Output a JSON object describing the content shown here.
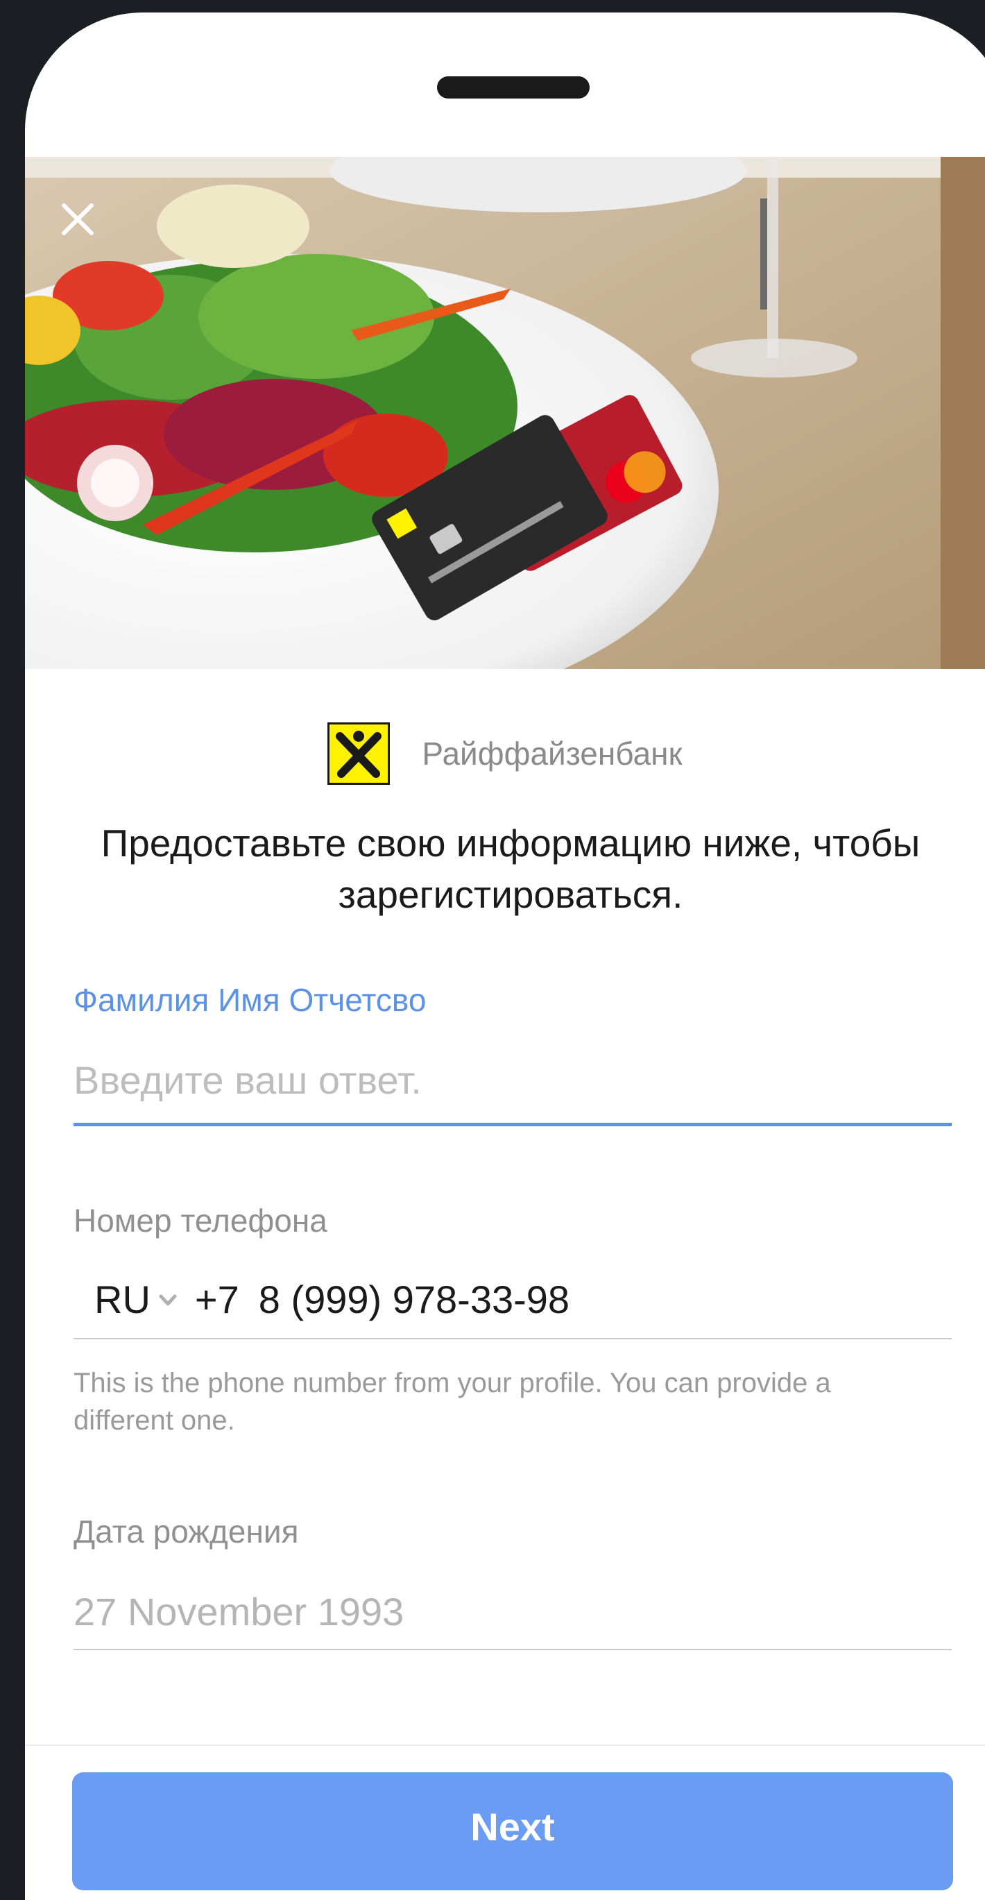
{
  "header": {
    "close_icon": "close-icon",
    "hero_image": "salad-with-raiffeisen-cards"
  },
  "brand": {
    "name": "Райффайзенбанк",
    "logo_icon": "raiffeisen-logo",
    "logo_color": "#fff200"
  },
  "form": {
    "headline": "Предоставьте свою информацию ниже, чтобы зарегистироваться.",
    "full_name": {
      "label": "Фамилия Имя Отчетсво",
      "placeholder": "Введите ваш ответ.",
      "value": ""
    },
    "phone": {
      "label": "Номер телефона",
      "country_code": "RU",
      "dial_code": "+7",
      "value": "8 (999) 978-33-98",
      "hint": "This is the phone number from your profile. You can provide a different one."
    },
    "birth_date": {
      "label": "Дата рождения",
      "value": "27 November 1993"
    }
  },
  "footer": {
    "next_label": "Next"
  },
  "colors": {
    "accent": "#5b92e5",
    "button": "#6a9cf4",
    "background": "#1b1f24"
  }
}
